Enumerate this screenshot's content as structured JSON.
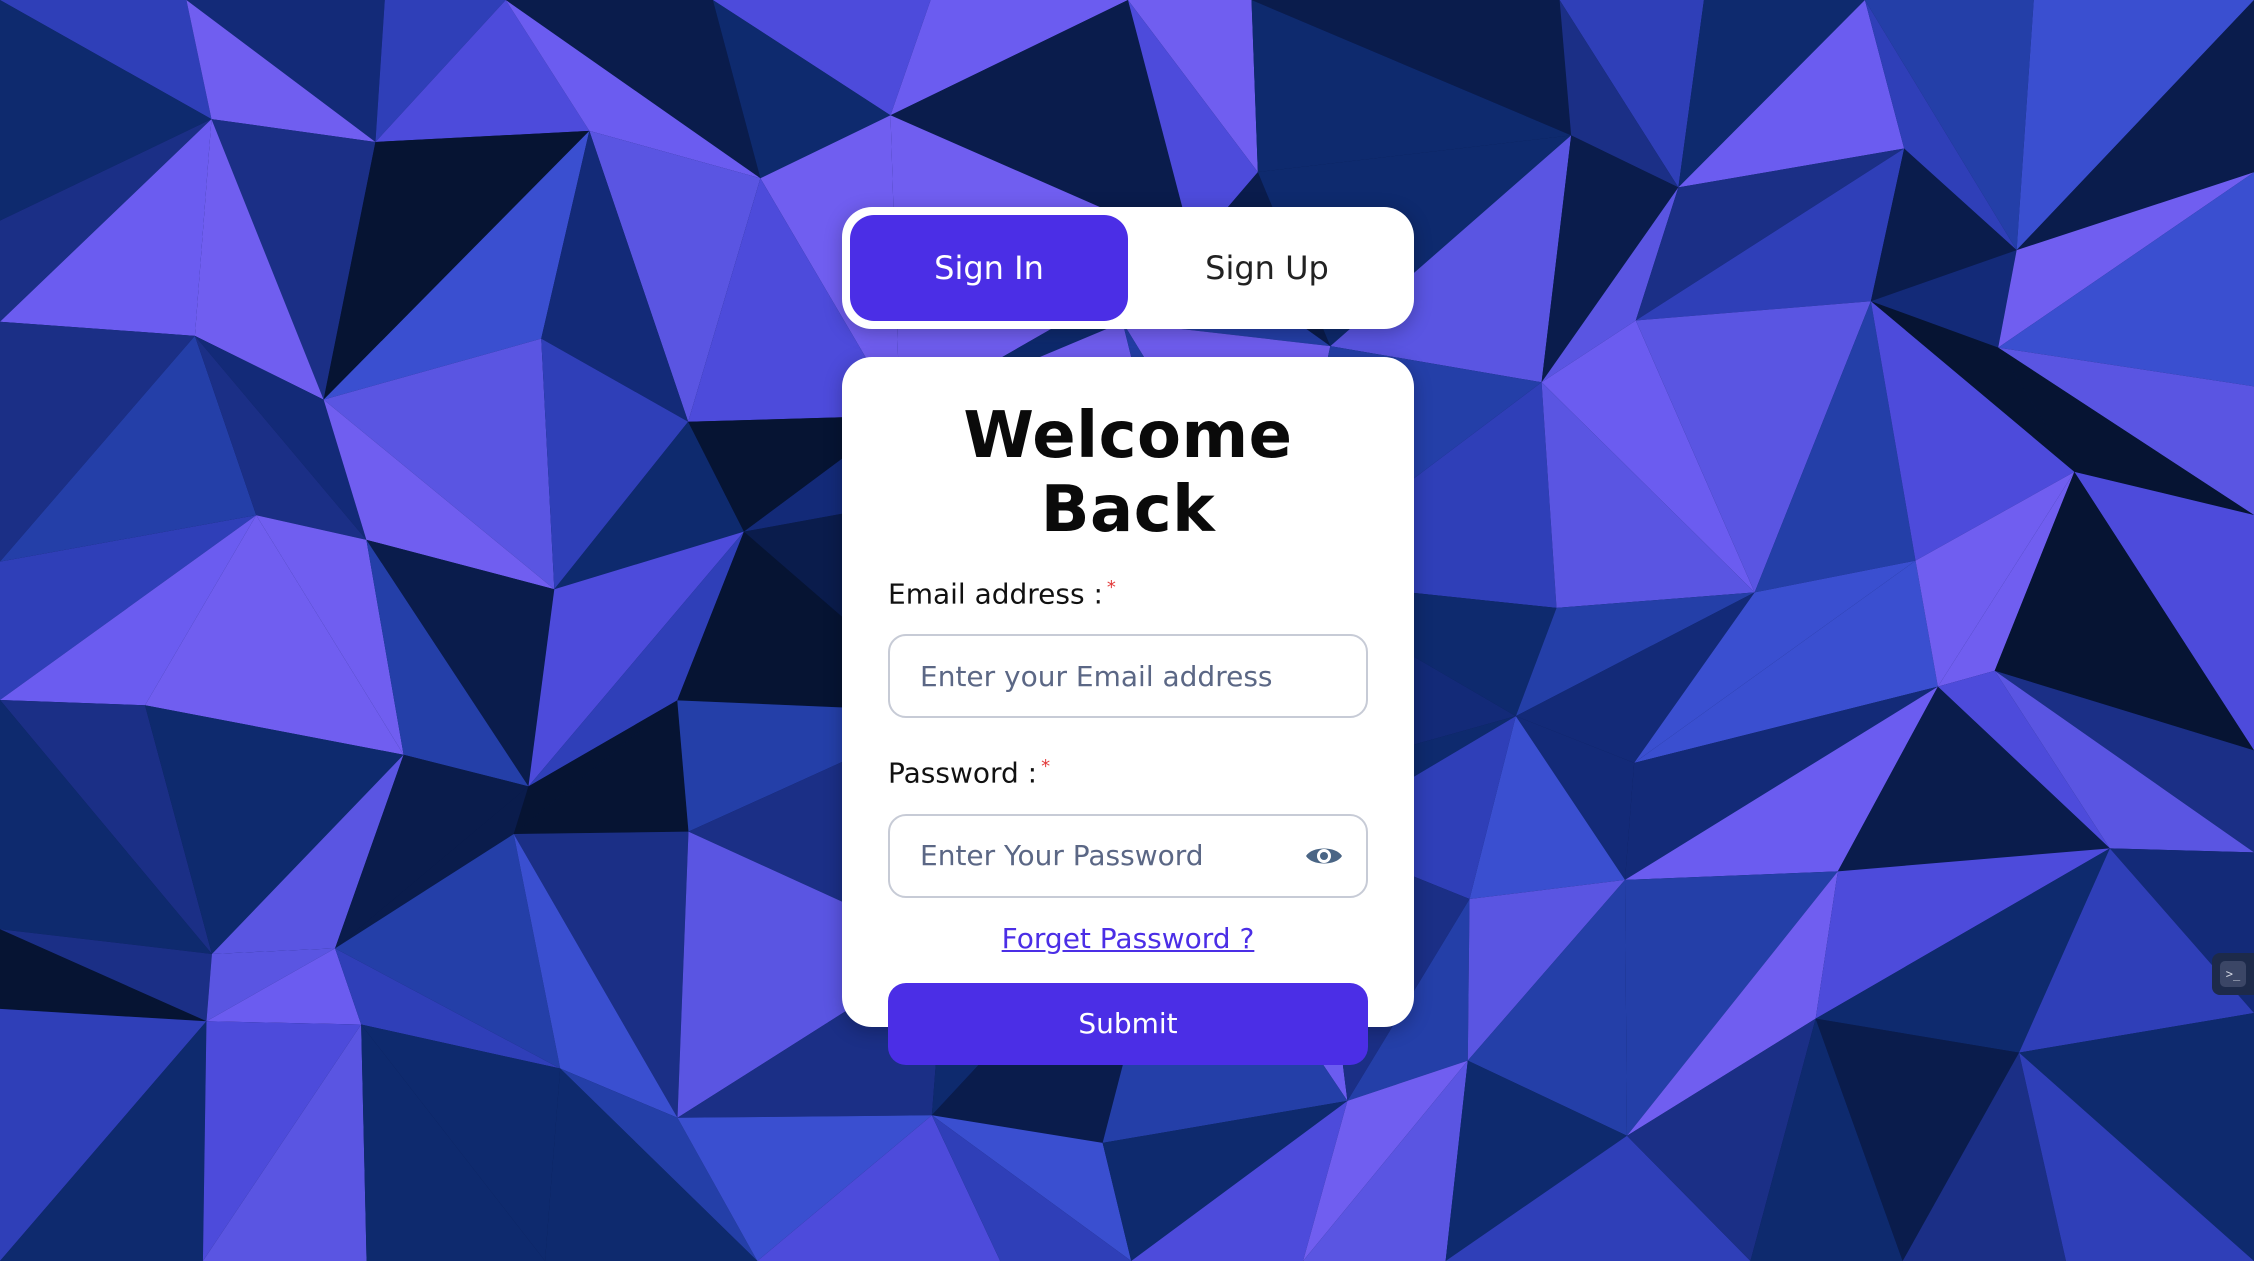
{
  "tabs": {
    "sign_in": "Sign In",
    "sign_up": "Sign Up"
  },
  "form": {
    "title": "Welcome Back",
    "email_label": "Email address :",
    "email_placeholder": "Enter your Email address",
    "password_label": "Password :",
    "password_placeholder": "Enter Your Password",
    "required_mark": "*",
    "forgot_link": "Forget Password ?",
    "submit_label": "Submit"
  },
  "icons": {
    "password_toggle": "eye-icon",
    "side_widget": "devtools-icon"
  },
  "colors": {
    "accent": "#4b2ee6",
    "required": "#e23a3a",
    "card": "#ffffff"
  }
}
